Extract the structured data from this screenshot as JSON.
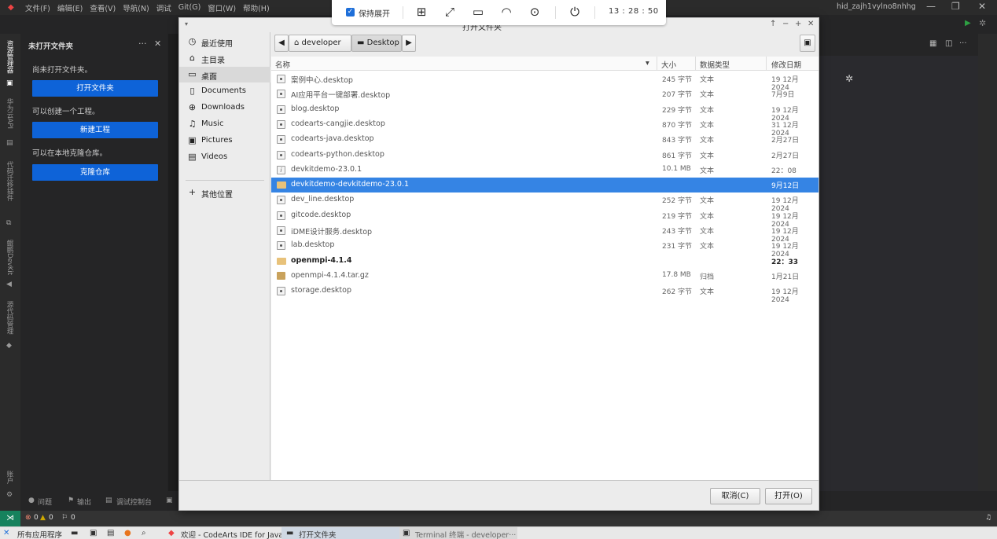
{
  "ide": {
    "menu": [
      "文件(F)",
      "编辑(E)",
      "查看(V)",
      "导航(N)",
      "调试",
      "Git(G)",
      "窗口(W)",
      "帮助(H)"
    ],
    "window_title": "hid_zajh1vylno8nhhg",
    "activity_labels": {
      "explorer": "资源管理器",
      "api": "华为云API",
      "code_check": "代码迁移插件",
      "devkit": "鲲鹏DevKit",
      "git": "源代码管理",
      "account": "账户"
    },
    "sidebar": {
      "title": "未打开文件夹",
      "no_folder_text": "尚未打开文件夹。",
      "open_folder_btn": "打开文件夹",
      "create_text": "可以创建一个工程。",
      "new_project_btn": "新建工程",
      "clone_text": "可以在本地克隆仓库。",
      "clone_btn": "克隆仓库"
    },
    "panel_tabs": [
      "问题",
      "输出",
      "调试控制台"
    ],
    "status": {
      "errors": "0",
      "warnings": "0",
      "ports": "0"
    }
  },
  "remote_toolbar": {
    "keep_expanded": "保持展开",
    "time": "13 : 28 : 50"
  },
  "dialog": {
    "title": "打开文件夹",
    "places": [
      {
        "icon": "clock-icon",
        "glyph": "◷",
        "label": "最近使用"
      },
      {
        "icon": "home-icon",
        "glyph": "⌂",
        "label": "主目录"
      },
      {
        "icon": "desktop-icon",
        "glyph": "▭",
        "label": "桌面",
        "selected": true
      },
      {
        "icon": "document-icon",
        "glyph": "▯",
        "label": "Documents"
      },
      {
        "icon": "download-icon",
        "glyph": "⊕",
        "label": "Downloads"
      },
      {
        "icon": "music-icon",
        "glyph": "♫",
        "label": "Music"
      },
      {
        "icon": "camera-icon",
        "glyph": "▣",
        "label": "Pictures"
      },
      {
        "icon": "film-icon",
        "glyph": "▤",
        "label": "Videos"
      }
    ],
    "other_locations": "其他位置",
    "path": [
      "developer",
      "Desktop"
    ],
    "columns": {
      "name": "名称",
      "size": "大小",
      "type": "数据类型",
      "modified": "修改日期"
    },
    "files": [
      {
        "name": "案例中心.desktop",
        "size": "245 字节",
        "type": "文本",
        "modified": "19 12月 2024",
        "icon": "doc"
      },
      {
        "name": "AI应用平台一键部署.desktop",
        "size": "207 字节",
        "type": "文本",
        "modified": "7月9日",
        "icon": "doc"
      },
      {
        "name": "blog.desktop",
        "size": "229 字节",
        "type": "文本",
        "modified": "19 12月 2024",
        "icon": "doc"
      },
      {
        "name": "codearts-cangjie.desktop",
        "size": "870 字节",
        "type": "文本",
        "modified": "31 12月 2024",
        "icon": "doc"
      },
      {
        "name": "codearts-java.desktop",
        "size": "843 字节",
        "type": "文本",
        "modified": "2月27日",
        "icon": "doc"
      },
      {
        "name": "codearts-python.desktop",
        "size": "861 字节",
        "type": "文本",
        "modified": "2月27日",
        "icon": "doc"
      },
      {
        "name": "devkitdemo-23.0.1",
        "size": "10.1 MB",
        "type": "文本",
        "modified": "22：08",
        "icon": "info"
      },
      {
        "name": "devkitdemo-devkitdemo-23.0.1",
        "size": "",
        "type": "",
        "modified": "9月12日",
        "icon": "folder",
        "selected": true
      },
      {
        "name": "dev_line.desktop",
        "size": "252 字节",
        "type": "文本",
        "modified": "19 12月 2024",
        "icon": "doc"
      },
      {
        "name": "gitcode.desktop",
        "size": "219 字节",
        "type": "文本",
        "modified": "19 12月 2024",
        "icon": "doc"
      },
      {
        "name": "iDME设计服务.desktop",
        "size": "243 字节",
        "type": "文本",
        "modified": "19 12月 2024",
        "icon": "doc"
      },
      {
        "name": "lab.desktop",
        "size": "231 字节",
        "type": "文本",
        "modified": "19 12月 2024",
        "icon": "doc"
      },
      {
        "name": "openmpi-4.1.4",
        "size": "",
        "type": "",
        "modified": "22：33",
        "icon": "folder",
        "bold": true
      },
      {
        "name": "openmpi-4.1.4.tar.gz",
        "size": "17.8 MB",
        "type": "归档",
        "modified": "1月21日",
        "icon": "archive"
      },
      {
        "name": "storage.desktop",
        "size": "262 字节",
        "type": "文本",
        "modified": "19 12月 2024",
        "icon": "doc"
      }
    ],
    "cancel_btn": "取消(C)",
    "open_btn": "打开(O)"
  },
  "taskbar": {
    "all_apps": "所有应用程序",
    "tasks": [
      "欢迎 - CodeArts IDE for Java",
      "打开文件夹",
      "Terminal 终端 - developer···"
    ]
  },
  "colors": {
    "accent": "#3584e4",
    "ide_button": "#0e63d8",
    "remote_green": "#16825d"
  }
}
